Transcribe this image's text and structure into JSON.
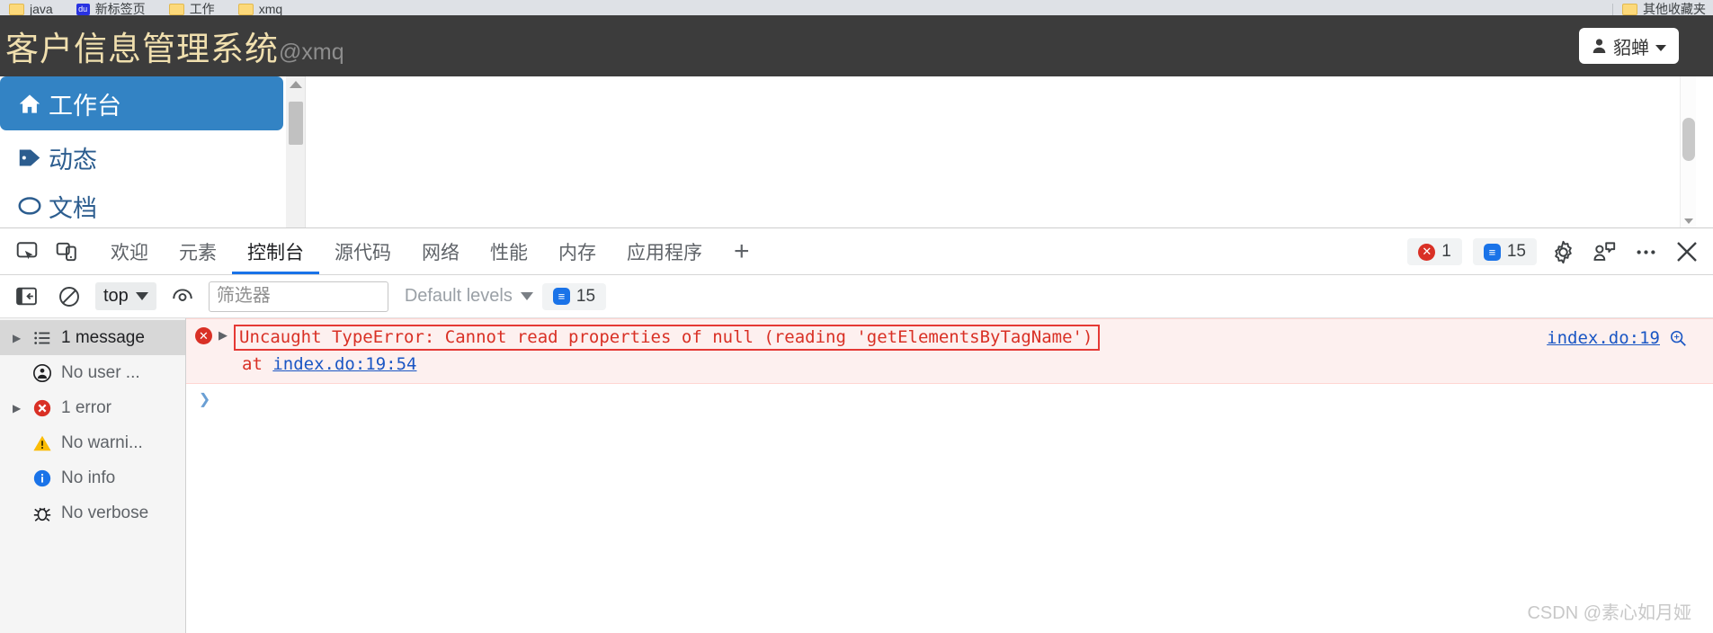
{
  "browser": {
    "bookmarks": [
      {
        "label": "java",
        "icon": "folder-icon"
      },
      {
        "label": "新标签页",
        "icon": "baidu-favicon"
      },
      {
        "label": "工作",
        "icon": "folder-icon"
      },
      {
        "label": "xmq",
        "icon": "folder-icon"
      }
    ],
    "other_bookmarks": {
      "label": "其他收藏夹",
      "icon": "folder-icon"
    }
  },
  "app": {
    "title": "客户信息管理系统",
    "subtitle": "@xmq",
    "header_bg": "#3c3c3c",
    "title_color": "#f0dfae",
    "user": {
      "name": "貂蝉",
      "avatar_icon": "user-icon",
      "caret_icon": "caret-down-icon"
    },
    "sidebar": {
      "items": [
        {
          "label": "工作台",
          "icon": "home-icon",
          "active": true
        },
        {
          "label": "动态",
          "icon": "tag-icon",
          "active": false
        },
        {
          "label": "文档",
          "icon": "comment-icon",
          "active": false
        }
      ],
      "active_bg": "#3383c4"
    }
  },
  "devtools": {
    "left_icons": [
      {
        "name": "inspect-element-icon"
      },
      {
        "name": "device-toolbar-icon"
      }
    ],
    "tabs": [
      {
        "label": "欢迎",
        "active": false
      },
      {
        "label": "元素",
        "active": false
      },
      {
        "label": "控制台",
        "active": true
      },
      {
        "label": "源代码",
        "active": false
      },
      {
        "label": "网络",
        "active": false
      },
      {
        "label": "性能",
        "active": false
      },
      {
        "label": "内存",
        "active": false
      },
      {
        "label": "应用程序",
        "active": false
      }
    ],
    "add_tab_label": "+",
    "error_badge": {
      "count": "1",
      "icon": "error-circle-icon",
      "color": "#d93025"
    },
    "message_badge": {
      "count": "15",
      "icon": "message-bubble-icon",
      "color": "#1a73e8"
    },
    "right_icons": [
      {
        "name": "settings-gear-icon"
      },
      {
        "name": "feedback-icon"
      },
      {
        "name": "more-options-icon"
      },
      {
        "name": "close-devtools-icon"
      }
    ],
    "console_toolbar": {
      "sidebar_toggle_icon": "console-sidebar-toggle-icon",
      "clear_icon": "clear-console-icon",
      "context": {
        "label": "top",
        "caret": "caret-down-icon"
      },
      "eye_icon": "live-expression-icon",
      "filter": {
        "placeholder": "筛选器",
        "value": ""
      },
      "levels": {
        "label": "Default levels",
        "caret": "caret-down-icon"
      },
      "toolbar_badge": {
        "count": "15",
        "icon": "message-bubble-icon"
      }
    },
    "console_sidebar": [
      {
        "label": "1 message",
        "icon": "list-icon",
        "arrow": true,
        "selected": true
      },
      {
        "label": "No user ...",
        "icon": "user-message-icon",
        "arrow": false,
        "selected": false
      },
      {
        "label": "1 error",
        "icon": "error-circle-icon",
        "arrow": true,
        "selected": false
      },
      {
        "label": "No warni...",
        "icon": "warning-triangle-icon",
        "arrow": false,
        "selected": false
      },
      {
        "label": "No info",
        "icon": "info-circle-icon",
        "arrow": false,
        "selected": false
      },
      {
        "label": "No verbose",
        "icon": "bug-icon",
        "arrow": false,
        "selected": false
      }
    ],
    "console_messages": {
      "error": {
        "icon": "error-circle-icon",
        "expand_arrow": "▶",
        "text": "Uncaught TypeError: Cannot read properties of null (reading 'getElementsByTagName')",
        "stack_prefix": "at ",
        "stack_link": "index.do:19:54",
        "source_link": "index.do:19",
        "search_icon": "search-in-source-icon",
        "highlight_border": "#e53935"
      },
      "prompt_chevron": "❯"
    }
  },
  "watermark": "CSDN @素心如月娅"
}
